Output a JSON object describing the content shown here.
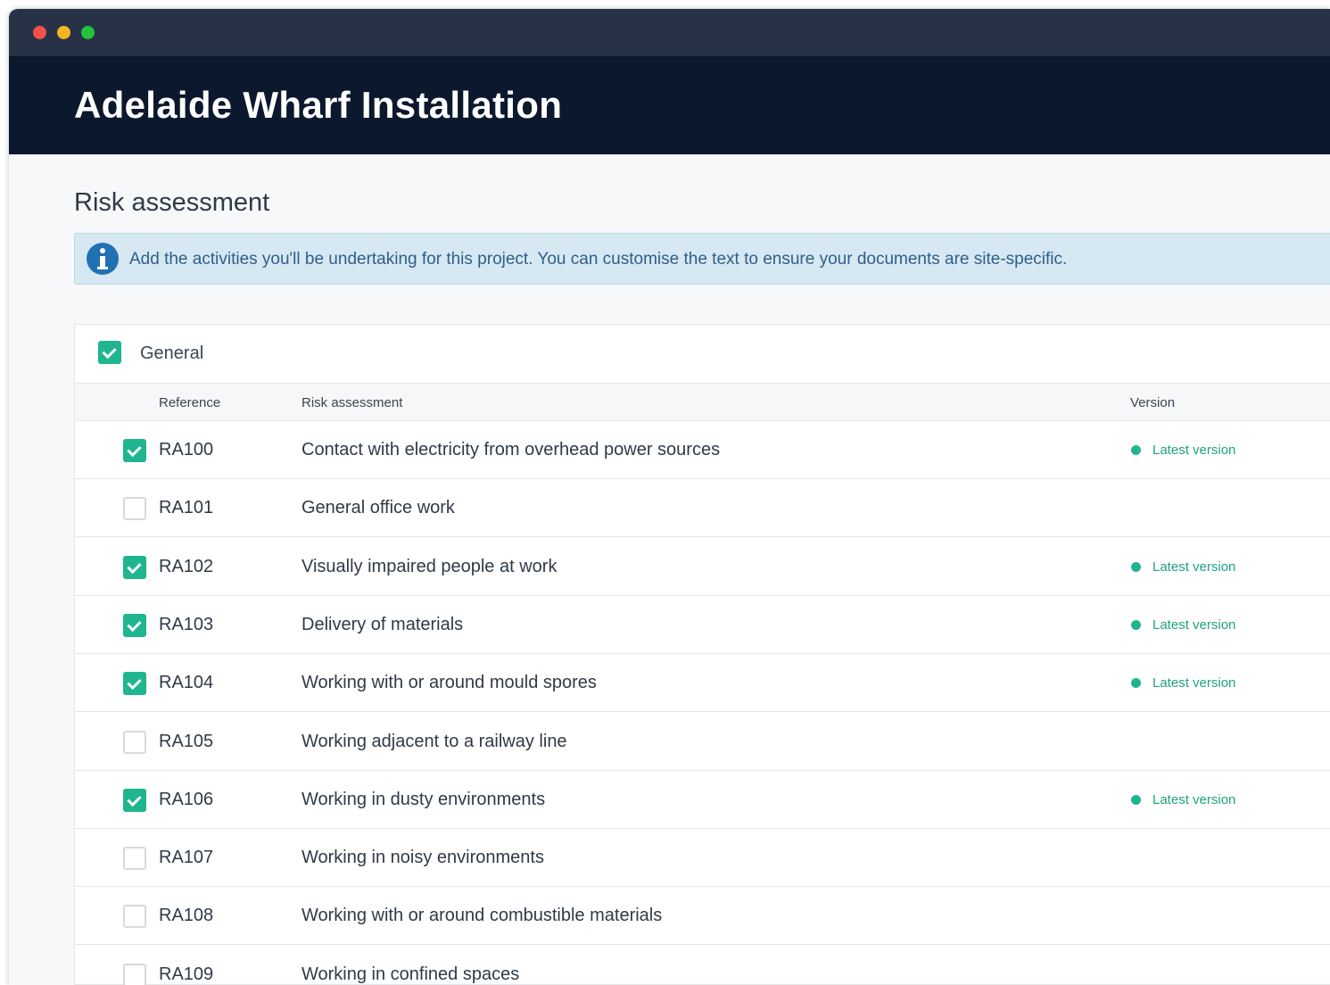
{
  "window": {
    "title": "Adelaide Wharf Installation",
    "traffic_lights": [
      "close",
      "minimize",
      "maximize"
    ]
  },
  "page": {
    "section_title": "Risk assessment",
    "info_icon": "info-icon",
    "info_text": "Add the activities you'll be undertaking for this project. You can customise the text to ensure your documents are site-specific."
  },
  "group": {
    "label": "General",
    "checked": true
  },
  "table": {
    "columns": {
      "reference": "Reference",
      "risk_assessment": "Risk assessment",
      "version": "Version"
    },
    "rows": [
      {
        "ref": "RA100",
        "title": "Contact with electricity from overhead power sources",
        "checked": true,
        "version": "Latest version"
      },
      {
        "ref": "RA101",
        "title": "General office work",
        "checked": false,
        "version": ""
      },
      {
        "ref": "RA102",
        "title": "Visually impaired people at work",
        "checked": true,
        "version": "Latest version"
      },
      {
        "ref": "RA103",
        "title": "Delivery of materials",
        "checked": true,
        "version": "Latest version"
      },
      {
        "ref": "RA104",
        "title": "Working with or around mould spores",
        "checked": true,
        "version": "Latest version"
      },
      {
        "ref": "RA105",
        "title": "Working adjacent to a railway line",
        "checked": false,
        "version": ""
      },
      {
        "ref": "RA106",
        "title": "Working in dusty environments",
        "checked": true,
        "version": "Latest version"
      },
      {
        "ref": "RA107",
        "title": "Working in noisy environments",
        "checked": false,
        "version": ""
      },
      {
        "ref": "RA108",
        "title": "Working with or around combustible materials",
        "checked": false,
        "version": ""
      },
      {
        "ref": "RA109",
        "title": "Working in confined spaces",
        "checked": false,
        "version": ""
      }
    ]
  },
  "colors": {
    "accent": "#1fb58f",
    "header_bg": "#0b182e",
    "chrome_bg": "#273247",
    "info_bg": "#d6e8f2"
  }
}
